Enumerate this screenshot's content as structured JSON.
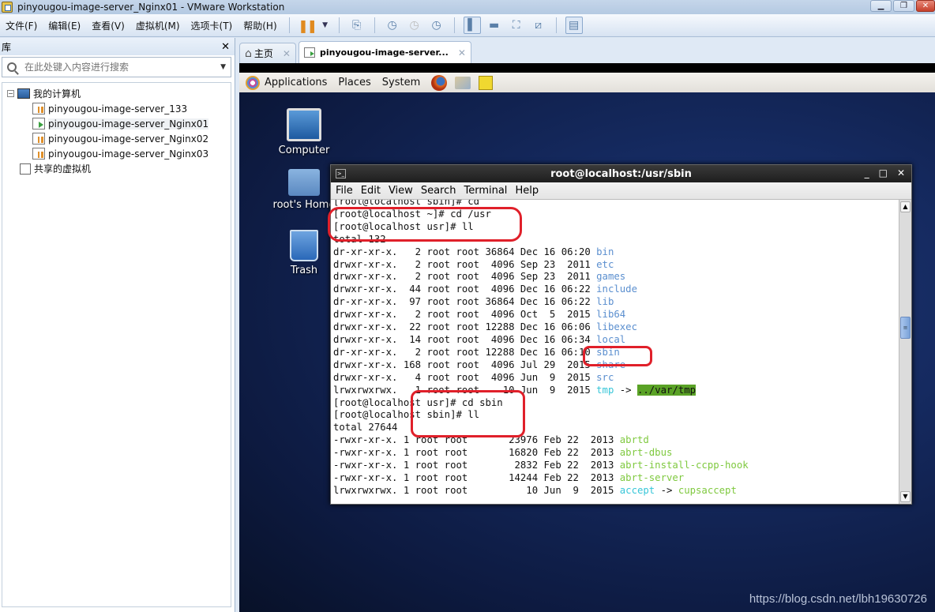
{
  "window": {
    "title": "pinyougou-image-server_Nginx01 - VMware Workstation"
  },
  "menubar": {
    "items": [
      "文件(F)",
      "编辑(E)",
      "查看(V)",
      "虚拟机(M)",
      "选项卡(T)",
      "帮助(H)"
    ]
  },
  "library": {
    "title": "库",
    "search_placeholder": "在此处键入内容进行搜索",
    "root": "我的计算机",
    "vms": [
      {
        "name": "pinyougou-image-server_133",
        "state": "stopped"
      },
      {
        "name": "pinyougou-image-server_Nginx01",
        "state": "running",
        "selected": true
      },
      {
        "name": "pinyougou-image-server_Nginx02",
        "state": "stopped"
      },
      {
        "name": "pinyougou-image-server_Nginx03",
        "state": "stopped"
      }
    ],
    "shared": "共享的虚拟机"
  },
  "tabs": [
    {
      "label": "主页",
      "icon": "home-icon"
    },
    {
      "label": "pinyougou-image-server...",
      "icon": "vm-running-icon",
      "active": true
    }
  ],
  "guest_panel": {
    "items": [
      "Applications",
      "Places",
      "System"
    ]
  },
  "desktop_icons": [
    "Computer",
    "root's Home",
    "Trash"
  ],
  "terminal": {
    "title": "root@localhost:/usr/sbin",
    "menu": [
      "File",
      "Edit",
      "View",
      "Search",
      "Terminal",
      "Help"
    ],
    "lines": [
      {
        "text": "[root@localhost sbin]# cd"
      },
      {
        "text": "[root@localhost ~]# cd /usr"
      },
      {
        "text": "[root@localhost usr]# ll"
      },
      {
        "text": "total 132"
      },
      {
        "prefix": "dr-xr-xr-x.   2 root root 36864 Dec 16 06:20 ",
        "name": "bin",
        "cls": "dir"
      },
      {
        "prefix": "drwxr-xr-x.   2 root root  4096 Sep 23  2011 ",
        "name": "etc",
        "cls": "dir"
      },
      {
        "prefix": "drwxr-xr-x.   2 root root  4096 Sep 23  2011 ",
        "name": "games",
        "cls": "dir"
      },
      {
        "prefix": "drwxr-xr-x.  44 root root  4096 Dec 16 06:22 ",
        "name": "include",
        "cls": "dir"
      },
      {
        "prefix": "dr-xr-xr-x.  97 root root 36864 Dec 16 06:22 ",
        "name": "lib",
        "cls": "dir"
      },
      {
        "prefix": "drwxr-xr-x.   2 root root  4096 Oct  5  2015 ",
        "name": "lib64",
        "cls": "dir"
      },
      {
        "prefix": "drwxr-xr-x.  22 root root 12288 Dec 16 06:06 ",
        "name": "libexec",
        "cls": "dir"
      },
      {
        "prefix": "drwxr-xr-x.  14 root root  4096 Dec 16 06:34 ",
        "name": "local",
        "cls": "dir"
      },
      {
        "prefix": "dr-xr-xr-x.   2 root root 12288 Dec 16 06:10 ",
        "name": "sbin",
        "cls": "dir"
      },
      {
        "prefix": "drwxr-xr-x. 168 root root  4096 Jul 29  2015 ",
        "name": "share",
        "cls": "dir"
      },
      {
        "prefix": "drwxr-xr-x.   4 root root  4096 Jun  9  2015 ",
        "name": "src",
        "cls": "dir"
      },
      {
        "prefix": "lrwxrwxrwx.   1 root root    10 Jun  9  2015 ",
        "name": "tmp",
        "cls": "lnk",
        "arrow": " -> ",
        "target": "../var/tmp",
        "target_cls": "hl"
      },
      {
        "text": "[root@localhost usr]# cd sbin"
      },
      {
        "text": "[root@localhost sbin]# ll"
      },
      {
        "text": "total 27644"
      },
      {
        "prefix": "-rwxr-xr-x. 1 root root       23976 Feb 22  2013 ",
        "name": "abrtd",
        "cls": "exe"
      },
      {
        "prefix": "-rwxr-xr-x. 1 root root       16820 Feb 22  2013 ",
        "name": "abrt-dbus",
        "cls": "exe"
      },
      {
        "prefix": "-rwxr-xr-x. 1 root root        2832 Feb 22  2013 ",
        "name": "abrt-install-ccpp-hook",
        "cls": "exe"
      },
      {
        "prefix": "-rwxr-xr-x. 1 root root       14244 Feb 22  2013 ",
        "name": "abrt-server",
        "cls": "exe"
      },
      {
        "prefix": "lrwxrwxrwx. 1 root root          10 Jun  9  2015 ",
        "name": "accept",
        "cls": "lnk",
        "arrow": " -> ",
        "target": "cupsaccept",
        "target_cls": "exe"
      }
    ]
  },
  "watermark": "https://blog.csdn.net/lbh19630726",
  "colors": {
    "dir": "#5b8fcf",
    "exe": "#7fc93f",
    "link": "#37c6d8",
    "annotation": "#e0202a"
  }
}
